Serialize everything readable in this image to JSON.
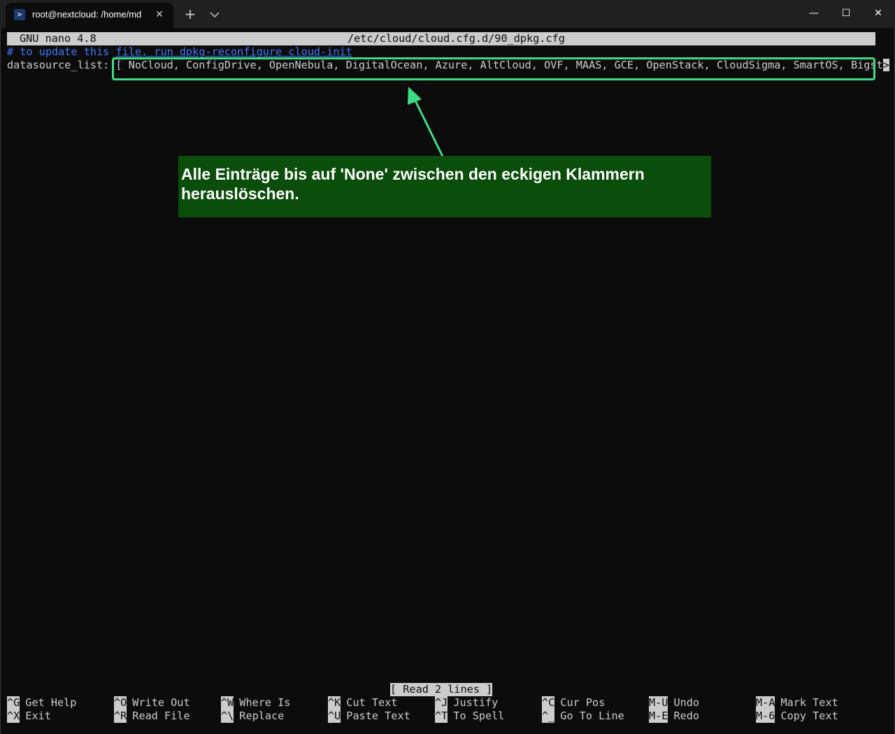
{
  "window": {
    "tab_title": "root@nextcloud: /home/md",
    "tab_icon": "powershell-icon",
    "tab_close": "✕",
    "new_tab": "+",
    "minimize": "—",
    "maximize": "☐",
    "close": "✕"
  },
  "nano": {
    "version": "GNU nano 4.8",
    "filename": "/etc/cloud/cloud.cfg.d/90_dpkg.cfg"
  },
  "file": {
    "comment_prefix": "# to update this ",
    "comment_link": "file, run dpkg-reconfigure cloud-init",
    "data_line": "datasource_list: [ NoCloud, ConfigDrive, OpenNebula, DigitalOcean, Azure, AltCloud, OVF, MAAS, GCE, OpenStack, CloudSigma, SmartOS, Bigst",
    "cursor_char": ">"
  },
  "annotation": {
    "note": "Alle Einträge bis auf 'None' zwischen den eckigen Klammern herauslöschen.",
    "box_color": "#3ddc84",
    "note_bg": "#0b4d0b"
  },
  "status": "[ Read 2 lines ]",
  "shortcuts": {
    "row1": [
      {
        "key": "^G",
        "label": "Get Help"
      },
      {
        "key": "^O",
        "label": "Write Out"
      },
      {
        "key": "^W",
        "label": "Where Is"
      },
      {
        "key": "^K",
        "label": "Cut Text"
      },
      {
        "key": "^J",
        "label": "Justify"
      },
      {
        "key": "^C",
        "label": "Cur Pos"
      },
      {
        "key": "M-U",
        "label": "Undo"
      },
      {
        "key": "M-A",
        "label": "Mark Text"
      }
    ],
    "row2": [
      {
        "key": "^X",
        "label": "Exit"
      },
      {
        "key": "^R",
        "label": "Read File"
      },
      {
        "key": "^\\",
        "label": "Replace"
      },
      {
        "key": "^U",
        "label": "Paste Text"
      },
      {
        "key": "^T",
        "label": "To Spell"
      },
      {
        "key": "^_",
        "label": "Go To Line"
      },
      {
        "key": "M-E",
        "label": "Redo"
      },
      {
        "key": "M-6",
        "label": "Copy Text"
      }
    ]
  }
}
